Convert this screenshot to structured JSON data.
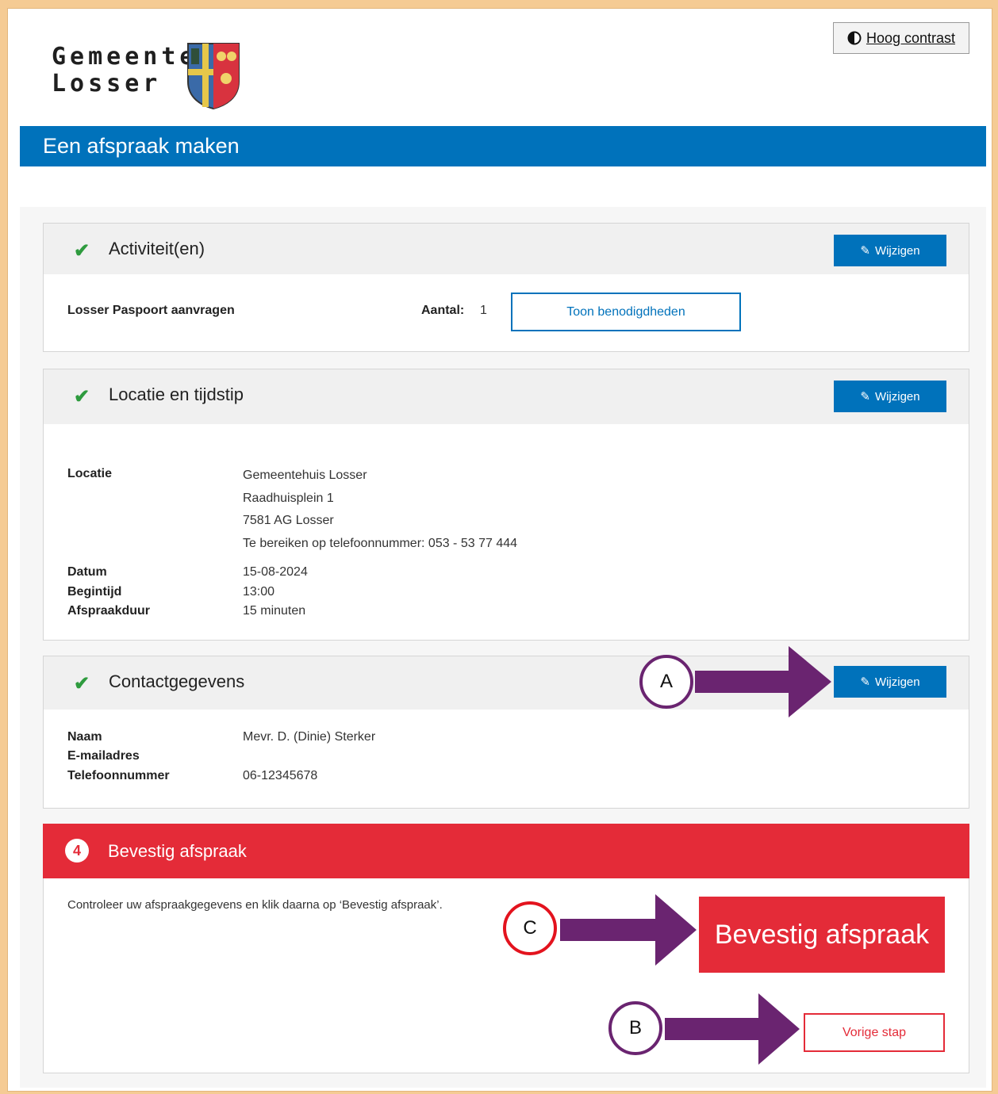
{
  "header": {
    "logo_line1": "Gemeente",
    "logo_line2": "Losser",
    "contrast_label": "Hoog contrast",
    "page_title": "Een afspraak maken"
  },
  "edit_label": "Wijzigen",
  "activities": {
    "title": "Activiteit(en)",
    "item_name": "Losser Paspoort aanvragen",
    "count_label": "Aantal:",
    "count_value": "1",
    "show_button": "Toon benodigdheden"
  },
  "location": {
    "title": "Locatie en tijdstip",
    "location_label": "Locatie",
    "address": [
      "Gemeentehuis Losser",
      "Raadhuisplein 1",
      "7581 AG Losser",
      "Te bereiken op telefoonnummer: 053 - 53 77 444"
    ],
    "date_label": "Datum",
    "date_value": "15-08-2024",
    "start_label": "Begintijd",
    "start_value": "13:00",
    "duration_label": "Afspraakduur",
    "duration_value": "15 minuten"
  },
  "contact": {
    "title": "Contactgegevens",
    "name_label": "Naam",
    "name_value": "Mevr. D. (Dinie) Sterker",
    "email_label": "E-mailadres",
    "phone_label": "Telefoonnummer",
    "phone_value": "06-12345678"
  },
  "confirm": {
    "step_number": "4",
    "title": "Bevestig afspraak",
    "instruction": "Controleer uw afspraakgegevens en klik daarna op ‘Bevestig afspraak’.",
    "confirm_button": "Bevestig afspraak",
    "previous_button": "Vorige stap"
  },
  "markers": {
    "a": "A",
    "b": "B",
    "c": "C"
  },
  "colors": {
    "primary_blue": "#0072bb",
    "confirm_red": "#e42b38",
    "arrow_purple": "#6a2470",
    "check_green": "#2e9b3e",
    "frame_orange": "#f5cb94"
  }
}
